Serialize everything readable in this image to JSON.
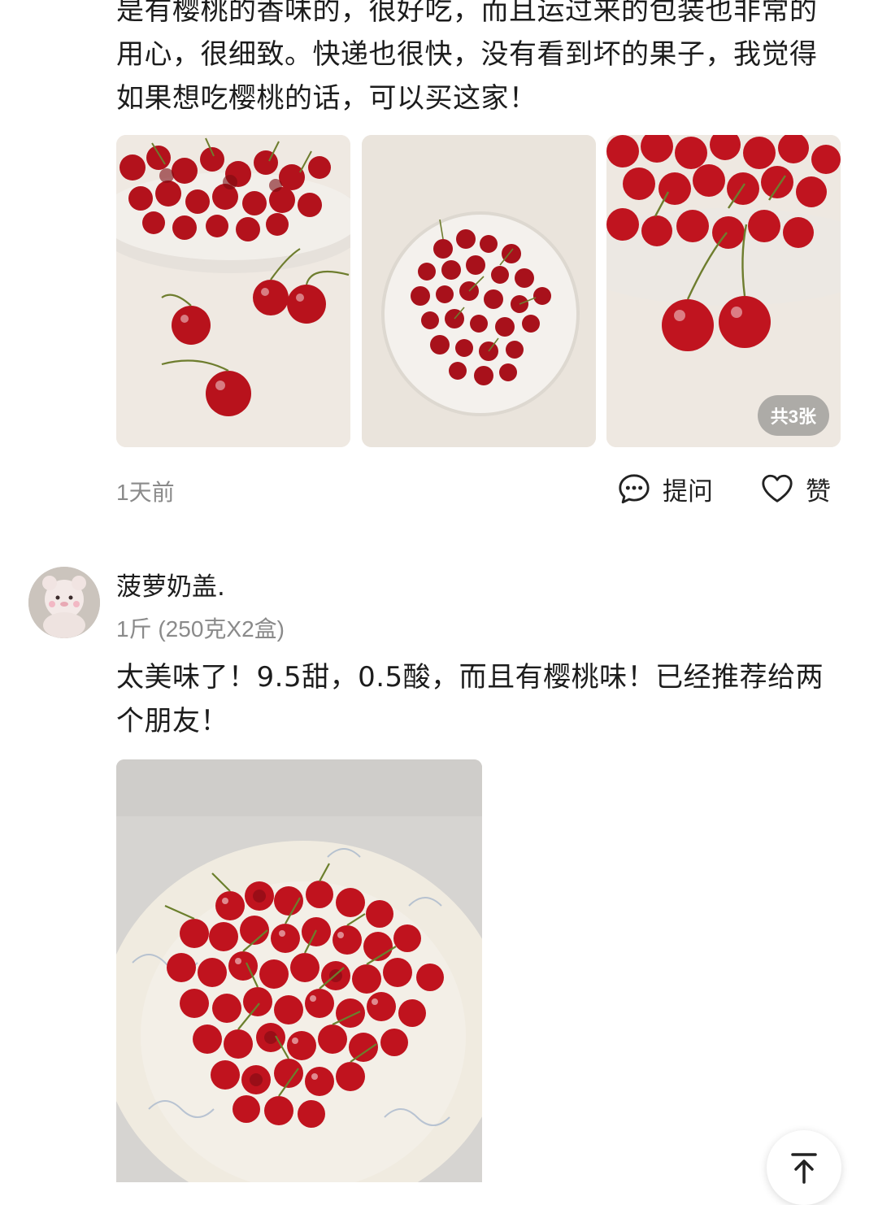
{
  "review1": {
    "text": "是有樱桃的香味的，很好吃，而且运过来的包装也非常的用心，很细致。快递也很快，没有看到坏的果子，我觉得如果想吃樱桃的话，可以买这家！",
    "photo_count_label": "共3张",
    "time": "1天前",
    "ask_label": "提问",
    "like_label": "赞"
  },
  "review2": {
    "username": "菠萝奶盖.",
    "spec": "1斤 (250克X2盒)",
    "text": "太美味了！9.5甜，0.5酸，而且有樱桃味！已经推荐给两个朋友！"
  },
  "icons": {
    "ask": "chat-bubble-icon",
    "like": "heart-icon",
    "back_to_top": "arrow-up-icon"
  },
  "colors": {
    "cherry": "#b5131d",
    "muted_text": "#8a8a8a"
  }
}
